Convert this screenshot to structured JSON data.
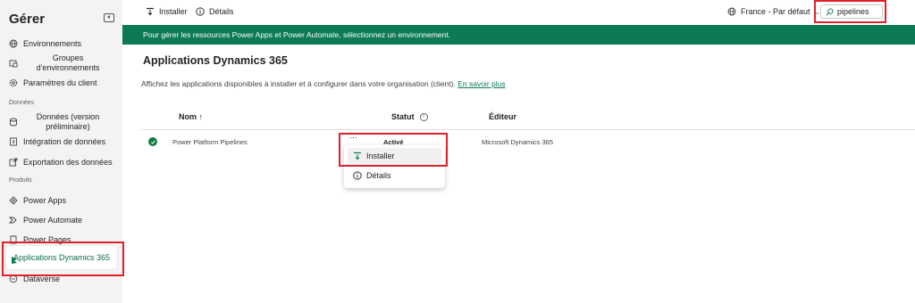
{
  "sidebar": {
    "title": "Gérer",
    "items": [
      {
        "label": "Environnements",
        "icon": "globe-icon"
      },
      {
        "label": "Groupes d'environnements",
        "icon": "env-groups-icon"
      },
      {
        "label": "Paramètres du client",
        "icon": "gear-icon"
      }
    ],
    "section_data": "Données",
    "data_items": [
      {
        "label": "Données (version préliminaire)",
        "icon": "data-icon"
      },
      {
        "label": "Intégration de données",
        "icon": "integration-icon"
      },
      {
        "label": "Exportation des données",
        "icon": "export-icon"
      }
    ],
    "section_products": "Produits",
    "product_items": [
      {
        "label": "Power Apps",
        "icon": "power-apps-icon"
      },
      {
        "label": "Power Automate",
        "icon": "power-automate-icon"
      },
      {
        "label": "Power Pages",
        "icon": "power-pages-icon"
      },
      {
        "label": "Applications Dynamics 365",
        "icon": "dynamics-icon",
        "active": true
      },
      {
        "label": "Dataverse",
        "icon": "dataverse-icon"
      }
    ]
  },
  "toolbar": {
    "install_label": "Installer",
    "details_label": "Détails",
    "region_label": "France - Par défaut",
    "search_value": "pipelines"
  },
  "banner": {
    "text": "Pour gérer les ressources Power Apps et Power Automate, sélectionnez un environnement."
  },
  "main": {
    "title": "Applications Dynamics 365",
    "description": "Affichez les applications disponibles à installer et à configurer dans votre organisation (client).",
    "learn_more": "En savoir plus",
    "columns": {
      "name": "Nom ↑",
      "status": "Statut",
      "editor": "Éditeur"
    },
    "rows": [
      {
        "name": "Power Platform Pipelines",
        "status": "Activé",
        "editor": "Microsoft Dynamics 365"
      }
    ]
  },
  "context_menu": {
    "items": [
      {
        "label": "Installer",
        "icon": "install-icon",
        "highlighted": true
      },
      {
        "label": "Détails",
        "icon": "info-icon"
      }
    ]
  },
  "colors": {
    "accent": "#0b7a55",
    "highlight_box": "#e0202a"
  }
}
